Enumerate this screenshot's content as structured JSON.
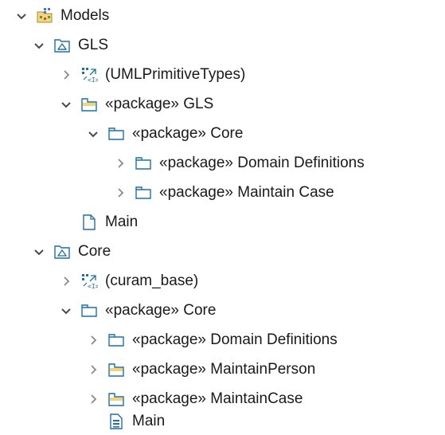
{
  "tree": {
    "rows": [
      {
        "label": "Models",
        "expanded": true,
        "icon": "models-project-icon"
      },
      {
        "label": "GLS",
        "expanded": true,
        "icon": "model-icon"
      },
      {
        "label": "(UMLPrimitiveTypes)",
        "expanded": false,
        "icon": "imported-library-icon"
      },
      {
        "label": "«package» GLS",
        "expanded": true,
        "icon": "package-yellow-icon"
      },
      {
        "label": "«package» Core",
        "expanded": true,
        "icon": "package-icon"
      },
      {
        "label": "«package» Domain Definitions",
        "expanded": false,
        "icon": "package-icon"
      },
      {
        "label": "«package» Maintain Case",
        "expanded": false,
        "icon": "package-icon"
      },
      {
        "label": "Main",
        "expanded": null,
        "icon": "diagram-icon"
      },
      {
        "label": "Core",
        "expanded": true,
        "icon": "model-icon"
      },
      {
        "label": "(curam_base)",
        "expanded": false,
        "icon": "imported-library-icon"
      },
      {
        "label": "«package» Core",
        "expanded": true,
        "icon": "package-icon"
      },
      {
        "label": "«package» Domain Definitions",
        "expanded": false,
        "icon": "package-icon"
      },
      {
        "label": "«package» MaintainPerson",
        "expanded": false,
        "icon": "package-yellow-icon"
      },
      {
        "label": "«package» MaintainCase",
        "expanded": false,
        "icon": "package-yellow-icon"
      },
      {
        "label": "Main",
        "expanded": null,
        "icon": "diagram-document-icon"
      }
    ]
  },
  "colors": {
    "folder_stroke": "#1e6fa8",
    "folder_fill": "#ffffff",
    "package_yellow": "#f2d675",
    "arrow": "#5a5a5a"
  }
}
